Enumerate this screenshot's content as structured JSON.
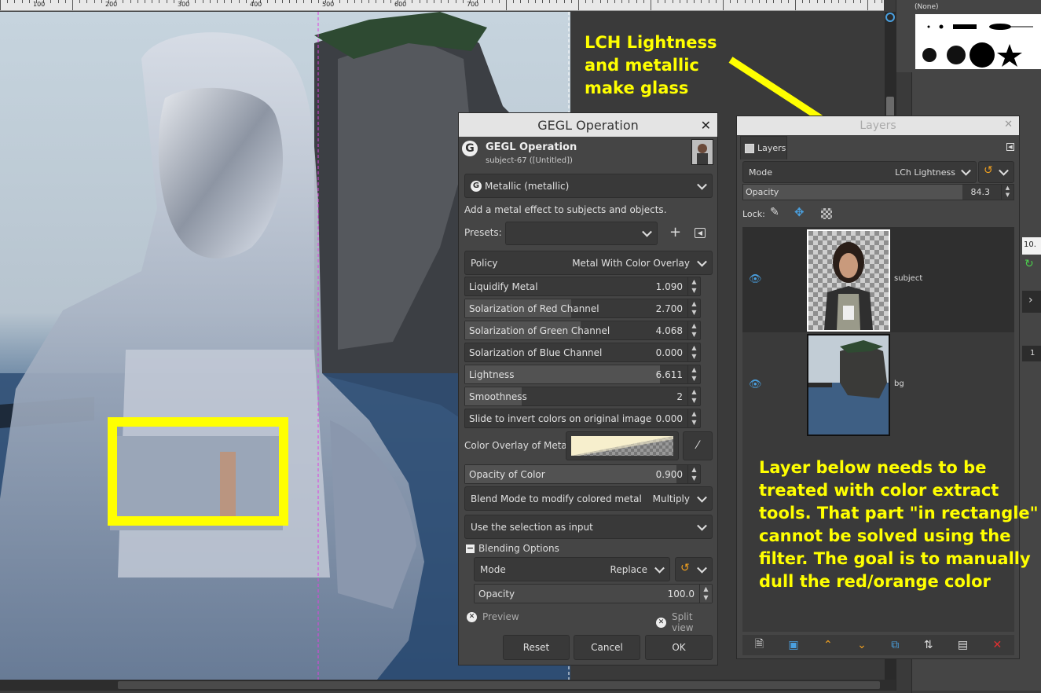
{
  "ruler": {
    "labels": [
      "100",
      "200",
      "300",
      "400",
      "500",
      "600",
      "700"
    ]
  },
  "annotations": {
    "top": [
      "LCH Lightness",
      "and metallic",
      "make glass"
    ],
    "bottom": [
      "Layer below needs to be",
      "treated with color extract",
      "tools. That part \"in rectangle\"",
      "cannot be solved using the",
      "filter. The goal is to manually",
      "dull the red/orange color"
    ],
    "color": "#ffff00"
  },
  "dock": {
    "brush_none": "(None)",
    "right_value": "10.",
    "right_value2": "1"
  },
  "gegl": {
    "window_title": "GEGL Operation",
    "header_title": "GEGL Operation",
    "header_sub": "subject-67 ([Untitled])",
    "operation": "Metallic (metallic)",
    "description": "Add a metal effect to subjects and objects.",
    "presets_label": "Presets:",
    "policy": {
      "label": "Policy",
      "value": "Metal With Color Overlay"
    },
    "sliders": [
      {
        "label": "Liquidify Metal",
        "value": "1.090",
        "fill": 0.0
      },
      {
        "label": "Solarization of Red Channel",
        "value": "2.700",
        "fill": 0.45
      },
      {
        "label": "Solarization of Green Channel",
        "value": "4.068",
        "fill": 0.49
      },
      {
        "label": "Solarization of Blue Channel",
        "value": "0.000",
        "fill": 0.0
      },
      {
        "label": "Lightness",
        "value": "6.611",
        "fill": 0.83
      },
      {
        "label": "Smoothness",
        "value": "2",
        "fill": 0.24
      },
      {
        "label": "Slide to invert colors on original image",
        "value": "0.000",
        "fill": 0.0
      }
    ],
    "color_overlay_label": "Color Overlay of Metal",
    "opacity_color": {
      "label": "Opacity of Color",
      "value": "0.900"
    },
    "blend_mode": {
      "label": "Blend Mode to modify colored metal",
      "value": "Multiply"
    },
    "selection_input": "Use the selection as input",
    "blending_options": "Blending Options",
    "mode": {
      "label": "Mode",
      "value": "Replace"
    },
    "opacity": {
      "label": "Opacity",
      "value": "100.0"
    },
    "preview": "Preview",
    "split_view": "Split view",
    "buttons": {
      "reset": "Reset",
      "cancel": "Cancel",
      "ok": "OK"
    }
  },
  "layers": {
    "window_title": "Layers",
    "tab": "Layers",
    "mode_label": "Mode",
    "mode_value": "LCh Lightness",
    "opacity_label": "Opacity",
    "opacity_value": "84.3",
    "lock_label": "Lock:",
    "items": [
      {
        "name": "subject"
      },
      {
        "name": "bg"
      }
    ]
  }
}
